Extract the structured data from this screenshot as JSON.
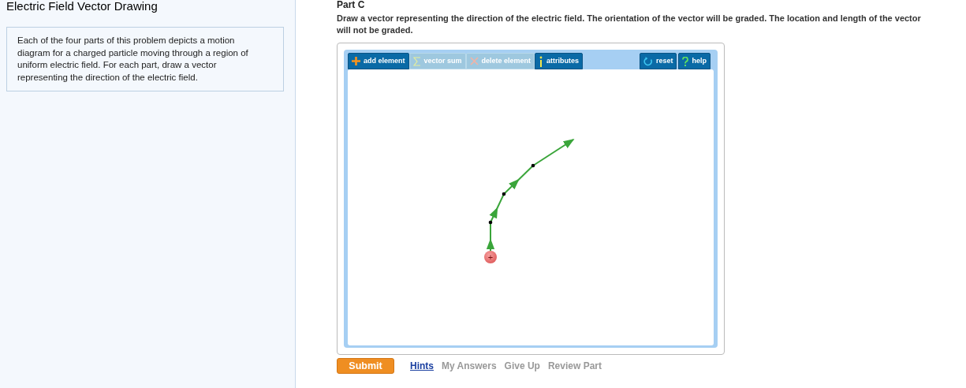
{
  "sidebar": {
    "title": "Electric Field Vector Drawing",
    "intro": "Each of the four parts of this problem depicts a motion diagram for a charged particle moving through a region of uniform electric field. For each part, draw a vector representing the direction of the electric field."
  },
  "part": {
    "title": "Part C",
    "prompt": "Draw a vector representing the direction of the electric field. The orientation of the vector will be graded. The location and length of the vector will not be graded."
  },
  "toolbar": [
    {
      "kind": "add",
      "label": "add element",
      "disabled": false
    },
    {
      "kind": "sum",
      "label": "vector sum",
      "disabled": true
    },
    {
      "kind": "delete",
      "label": "delete element",
      "disabled": true
    },
    {
      "kind": "attributes",
      "label": "attributes",
      "disabled": false
    },
    {
      "kind": "reset",
      "label": "reset",
      "disabled": false
    },
    {
      "kind": "help",
      "label": "help",
      "disabled": false
    }
  ],
  "particle": {
    "charge": "+"
  },
  "submit": "Submit",
  "links": [
    {
      "label": "Hints",
      "disabled": false
    },
    {
      "label": "My Answers",
      "disabled": true
    },
    {
      "label": "Give Up",
      "disabled": true
    },
    {
      "label": "Review Part",
      "disabled": true
    }
  ]
}
